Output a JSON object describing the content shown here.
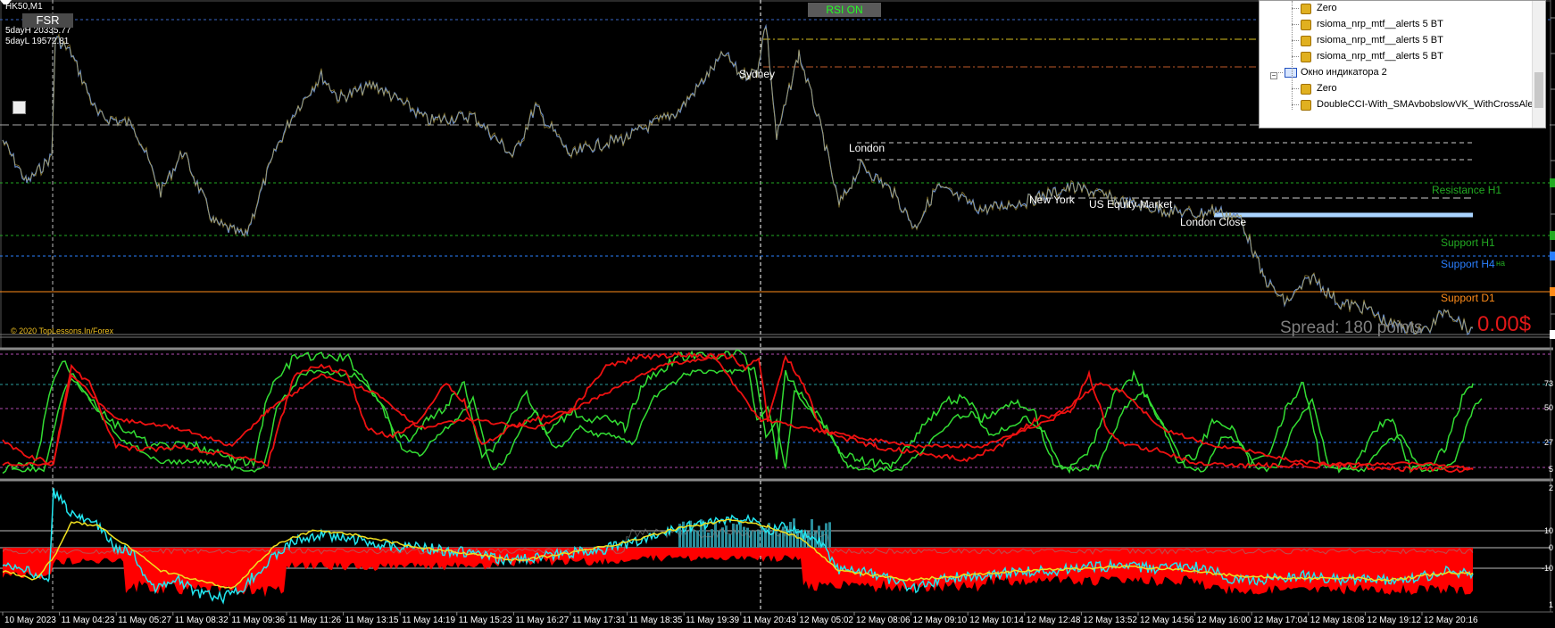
{
  "chart_header": {
    "symbol_timeframe": "HK50,M1",
    "five_day_high": "5dayH 20335.77",
    "five_day_low": "5dayL 19572.81",
    "fsr_button": "FSR",
    "rsi_button": "RSI ON",
    "copyright": "© 2020 TopLessons.In/Forex"
  },
  "sessions": {
    "sydney": "Sydney",
    "london": "London",
    "new_york": "New York",
    "us_equity": "US Equity Market",
    "london_close": "London Close"
  },
  "levels": {
    "resistance_h1": "Resistance H1",
    "support_h1": "Support H1",
    "support_h4": "Support H4",
    "support_d1": "Support D1",
    "support_h4_extra": "на"
  },
  "info": {
    "spread": "Spread: 180 points",
    "profit": "0.00$"
  },
  "navigator": {
    "items": [
      {
        "label": "Zero",
        "indent": 1
      },
      {
        "label": "rsioma_nrp_mtf__alerts 5 BT",
        "indent": 1
      },
      {
        "label": "rsioma_nrp_mtf__alerts 5 BT",
        "indent": 1
      },
      {
        "label": "rsioma_nrp_mtf__alerts 5 BT",
        "indent": 1
      },
      {
        "label": "Окно индикатора 2",
        "indent": 0
      },
      {
        "label": "Zero",
        "indent": 1
      },
      {
        "label": "DoubleCCI-With_SMAvbobslowVK_WithCrossAlert",
        "indent": 1
      }
    ]
  },
  "rsi_axis": [
    "73",
    "50",
    "27",
    "5"
  ],
  "cci_axis": [
    "2",
    "10",
    "0",
    "-10",
    "1"
  ],
  "time_axis": [
    "10 May 2023",
    "11 May 04:23",
    "11 May 05:27",
    "11 May 08:32",
    "11 May 09:36",
    "11 May 11:26",
    "11 May 13:15",
    "11 May 14:19",
    "11 May 15:23",
    "11 May 16:27",
    "11 May 17:31",
    "11 May 18:35",
    "11 May 19:39",
    "11 May 20:43",
    "12 May 05:02",
    "12 May 08:06",
    "12 May 09:10",
    "12 May 10:14",
    "12 May 12:48",
    "12 May 13:52",
    "12 May 14:56",
    "12 May 16:00",
    "12 May 17:04",
    "12 May 18:08",
    "12 May 19:12",
    "12 May 20:16"
  ],
  "colors": {
    "price": "#6c8fc8",
    "price_alt": "#b8a040",
    "rsi_green": "#33dd33",
    "rsi_red": "#ee1111",
    "cci_cyan": "#22e6f0",
    "cci_yellow": "#f0e020",
    "hist_red": "#ff0000",
    "hist_teal": "#2a8c9a",
    "support_green": "#22aa22",
    "support_blue": "#2a7fff",
    "support_orange": "#ff8c1a"
  }
}
